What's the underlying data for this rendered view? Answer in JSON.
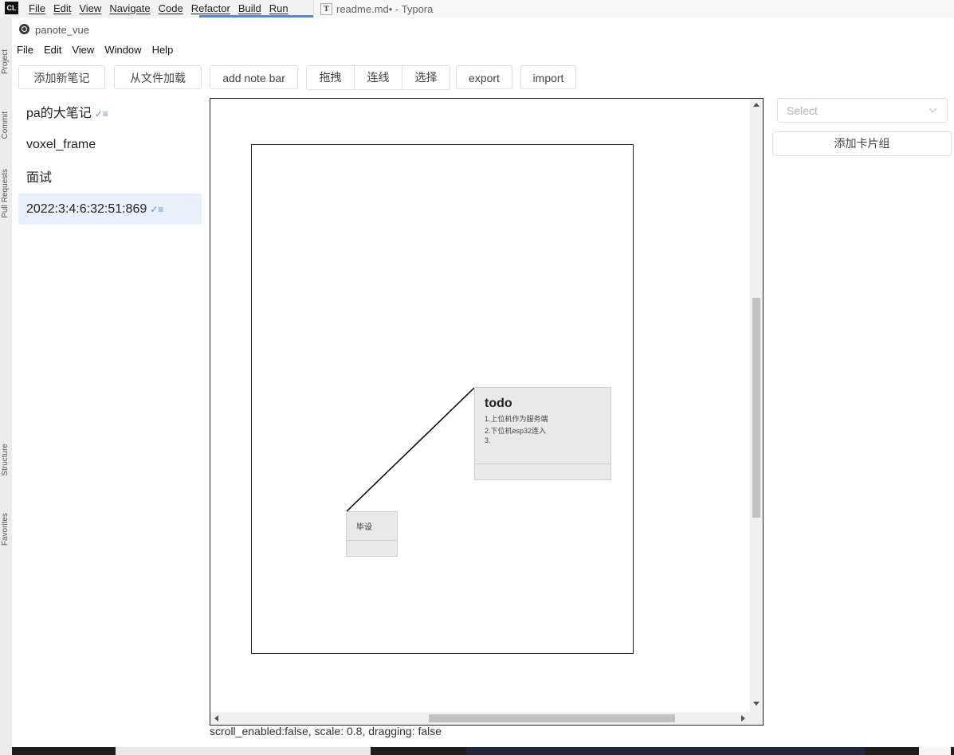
{
  "ide": {
    "logo": "CL",
    "menu": [
      "File",
      "Edit",
      "View",
      "Navigate",
      "Code",
      "Refactor",
      "Build",
      "Run"
    ],
    "side_tabs": [
      "Project",
      "Commit",
      "Pull Requests",
      "Structure",
      "Favorites"
    ]
  },
  "typora": {
    "icon": "T",
    "title": "readme.md• - Typora"
  },
  "app": {
    "title": "panote_vue",
    "menu": [
      "File",
      "Edit",
      "View",
      "Window",
      "Help"
    ]
  },
  "toolbar": {
    "add_note": "添加新笔记",
    "load_file": "从文件加载",
    "add_note_bar": "add note bar",
    "mode_buttons": [
      "拖拽",
      "连线",
      "选择"
    ],
    "export": "export",
    "import": "import"
  },
  "notes": [
    {
      "label": "pa的大笔记",
      "checked": true
    },
    {
      "label": "voxel_frame",
      "checked": false
    },
    {
      "label": "面试",
      "checked": false
    },
    {
      "label": "2022:3:4:6:32:51:869",
      "checked": true,
      "active": true
    }
  ],
  "cards": {
    "todo": {
      "title": "todo",
      "lines": [
        "1.上位机作为服务端",
        "2.下位机esp32连入",
        "3."
      ]
    },
    "bishe": {
      "text": "毕设"
    }
  },
  "status_text": "scroll_enabled:false, scale: 0.8, dragging: false",
  "right_panel": {
    "select_placeholder": "Select",
    "add_group": "添加卡片组"
  },
  "colors": {
    "active_note_bg": "#e8f1fb",
    "card_bg": "#e9e9e9",
    "check_icon": "#5a8cc4"
  }
}
